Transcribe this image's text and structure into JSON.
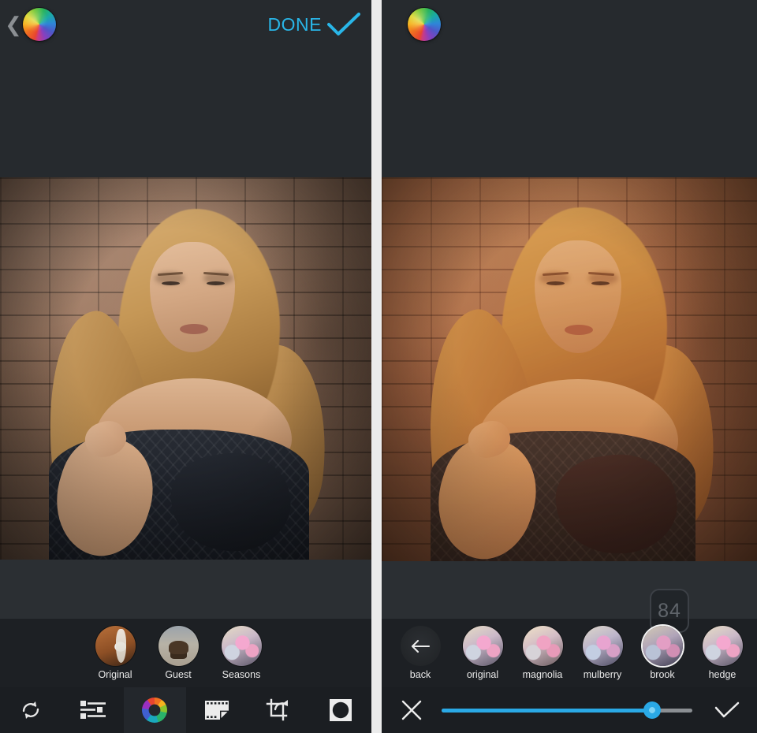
{
  "app": {
    "background": "#262a2e",
    "toolbar_background": "#1b1e22",
    "accent": "#29b6e8",
    "slider_accent": "#2aa9e6"
  },
  "left_panel": {
    "topbar": {
      "back_icon": "chevron-left-icon",
      "logo_icon": "color-wheel-logo-icon",
      "done_label": "DONE",
      "done_icon": "check-icon"
    },
    "photo": {
      "alt": "portrait of blonde woman in dark knit sweater against brick wall",
      "treatment": "original"
    },
    "filter_strip": {
      "items": [
        {
          "label": "Original",
          "thumb": "horse-thumb",
          "selected": false
        },
        {
          "label": "Guest",
          "thumb": "bison-thumb",
          "selected": false
        },
        {
          "label": "Seasons",
          "thumb": "flower-thumb",
          "selected": false
        }
      ]
    },
    "toolbar": {
      "items": [
        {
          "name": "reset-rotate-button",
          "icon": "rotate-refresh-icon",
          "active": false
        },
        {
          "name": "adjust-button",
          "icon": "sliders-icon",
          "active": false
        },
        {
          "name": "color-button",
          "icon": "color-wheel-icon",
          "active": true
        },
        {
          "name": "filters-button",
          "icon": "film-strip-icon",
          "active": false
        },
        {
          "name": "crop-rotate-button",
          "icon": "crop-rotate-icon",
          "active": false
        },
        {
          "name": "vignette-button",
          "icon": "vignette-icon",
          "active": false
        }
      ]
    }
  },
  "right_panel": {
    "topbar": {
      "logo_icon": "color-wheel-logo-icon"
    },
    "photo": {
      "alt": "same portrait with warm orange filter applied",
      "treatment": "brook filter, warm orange tone"
    },
    "value_badge": {
      "value": "84",
      "attached_to": "brook"
    },
    "filter_strip": {
      "back": {
        "label": "back",
        "icon": "arrow-left-icon"
      },
      "items": [
        {
          "label": "original",
          "thumb": "flower-thumb",
          "selected": false
        },
        {
          "label": "magnolia",
          "thumb": "flower-thumb-warm",
          "selected": false
        },
        {
          "label": "mulberry",
          "thumb": "flower-thumb-cool",
          "selected": false
        },
        {
          "label": "brook",
          "thumb": "flower-thumb-dark",
          "selected": true
        },
        {
          "label": "hedge",
          "thumb": "flower-thumb",
          "selected": false
        }
      ]
    },
    "toolbar": {
      "cancel_icon": "close-x-icon",
      "confirm_icon": "check-icon",
      "slider": {
        "name": "intensity-slider",
        "value": 84,
        "min": 0,
        "max": 100
      }
    }
  }
}
